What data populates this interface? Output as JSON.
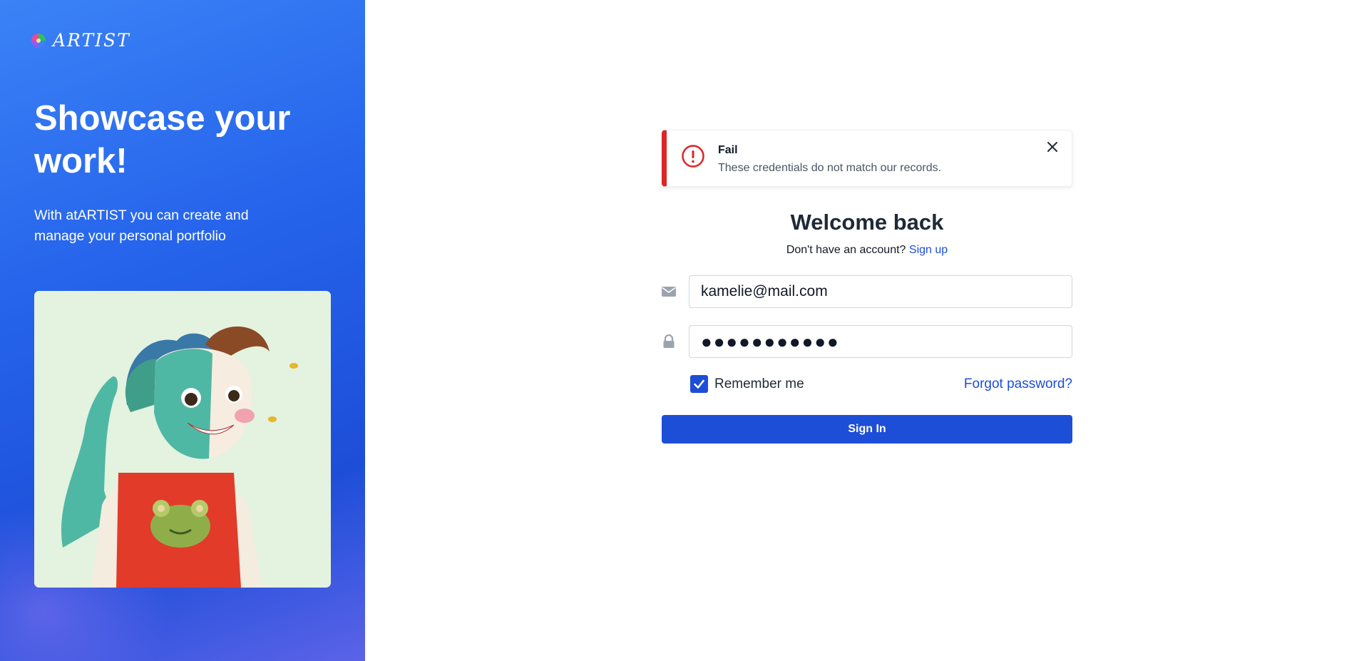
{
  "brand": {
    "logo_text": "ARTIST",
    "colors": {
      "panel": "#2563eb",
      "accent": "#1d4ed8",
      "error": "#dc2626"
    }
  },
  "hero": {
    "title": "Showcase your work!",
    "subtitle": "With atARTIST you can create and manage your personal portfolio"
  },
  "alert": {
    "title": "Fail",
    "message": "These credentials do not match our records.",
    "icon": "exclamation-circle-icon",
    "close_icon": "close-icon"
  },
  "form": {
    "heading": "Welcome back",
    "signup_prompt": "Don't have an account?",
    "signup_link": "Sign up",
    "email_value": "kamelie@mail.com",
    "email_icon": "envelope-icon",
    "password_value": "●●●●●●●●●●●",
    "password_icon": "lock-icon",
    "remember_label": "Remember me",
    "remember_checked": true,
    "forgot_link": "Forgot password?",
    "submit_label": "Sign In"
  }
}
